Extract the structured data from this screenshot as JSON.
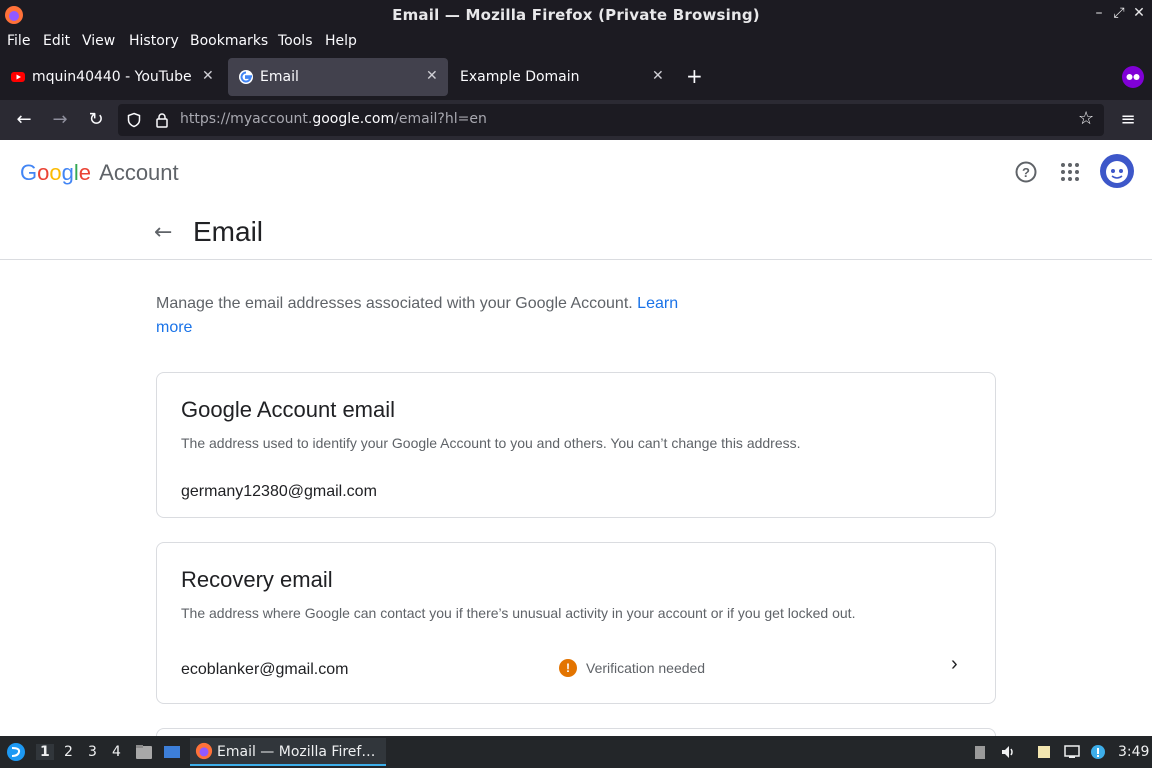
{
  "window": {
    "title": "Email — Mozilla Firefox (Private Browsing)"
  },
  "menu": {
    "file": "File",
    "edit": "Edit",
    "view": "View",
    "history": "History",
    "bookmarks": "Bookmarks",
    "tools": "Tools",
    "help": "Help"
  },
  "tabs": [
    {
      "label": "mquin40440 - YouTube"
    },
    {
      "label": "Email"
    },
    {
      "label": "Example Domain"
    }
  ],
  "urlbar": {
    "prefix": "https://myaccount.",
    "domain": "google.com",
    "suffix": "/email?hl=en"
  },
  "page": {
    "logo_google": "Google",
    "logo_account": "Account",
    "title": "Email",
    "intro": "Manage the email addresses associated with your Google Account.",
    "learn_more": "Learn more",
    "google_account_card": {
      "heading": "Google Account email",
      "description": "The address used to identify your Google Account to you and others. You can’t change this address.",
      "email": "germany12380@gmail.com"
    },
    "recovery_card": {
      "heading": "Recovery email",
      "description": "The address where Google can contact you if there’s unusual activity in your account or if you get locked out.",
      "email": "ecoblanker@gmail.com",
      "status": "Verification needed",
      "status_color": "#e37400"
    }
  },
  "taskbar": {
    "workspaces": [
      "1",
      "2",
      "3",
      "4"
    ],
    "task_label": "Email — Mozilla Firef…",
    "clock": "3:49"
  },
  "colors": {
    "link": "#1a73e8",
    "private_purple": "#8000d7",
    "google_blue": "#4285f4",
    "google_red": "#ea4335",
    "google_yellow": "#fbbc05",
    "google_green": "#34a853"
  }
}
